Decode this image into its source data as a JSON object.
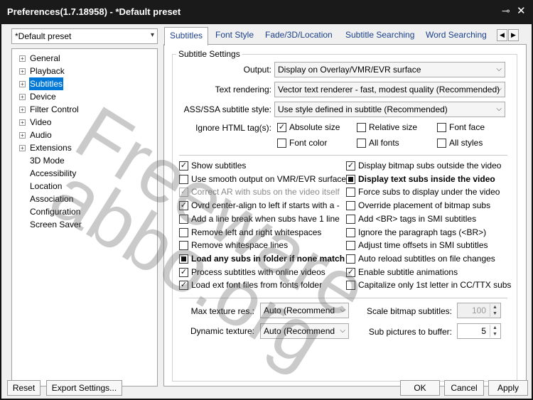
{
  "window": {
    "title": "Preferences(1.7.18958) - *Default preset",
    "pin_icon": "pin-icon",
    "close_icon": "close-icon"
  },
  "preset": {
    "value": "*Default preset"
  },
  "tree": [
    {
      "label": "General",
      "expandable": true
    },
    {
      "label": "Playback",
      "expandable": true
    },
    {
      "label": "Subtitles",
      "expandable": true,
      "selected": true
    },
    {
      "label": "Device",
      "expandable": true
    },
    {
      "label": "Filter Control",
      "expandable": true
    },
    {
      "label": "Video",
      "expandable": true
    },
    {
      "label": "Audio",
      "expandable": true
    },
    {
      "label": "Extensions",
      "expandable": true
    },
    {
      "label": "3D Mode",
      "expandable": false
    },
    {
      "label": "Accessibility",
      "expandable": false
    },
    {
      "label": "Location",
      "expandable": false
    },
    {
      "label": "Association",
      "expandable": false
    },
    {
      "label": "Configuration",
      "expandable": false
    },
    {
      "label": "Screen Saver",
      "expandable": false
    }
  ],
  "tabs": [
    "Subtitles",
    "Font Style",
    "Fade/3D/Location",
    "Subtitle Searching",
    "Word Searching"
  ],
  "settings": {
    "group_title": "Subtitle Settings",
    "output_label": "Output:",
    "output_value": "Display on Overlay/VMR/EVR surface",
    "text_rendering_label": "Text rendering:",
    "text_rendering_value": "Vector text renderer - fast, modest quality (Recommended)",
    "ass_label": "ASS/SSA subtitle style:",
    "ass_value": "Use style defined in subtitle (Recommended)",
    "html_label": "Ignore HTML tag(s):",
    "html_tags": [
      {
        "label": "Absolute size",
        "checked": true
      },
      {
        "label": "Relative size",
        "checked": false
      },
      {
        "label": "Font face",
        "checked": false
      },
      {
        "label": "Font color",
        "checked": false
      },
      {
        "label": "All fonts",
        "checked": false
      },
      {
        "label": "All styles",
        "checked": false
      }
    ]
  },
  "left_options": [
    {
      "label": "Show subtitles",
      "state": "checked"
    },
    {
      "label": "Use smooth output on VMR/EVR surface",
      "state": "unchecked"
    },
    {
      "label": "Correct AR with subs on the video itself",
      "state": "checked",
      "disabled": true
    },
    {
      "label": "Ovrd center-align to left if starts with a -",
      "state": "checked"
    },
    {
      "label": "Add a line break when subs have 1 line",
      "state": "unchecked"
    },
    {
      "label": "Remove left and right whitespaces",
      "state": "unchecked"
    },
    {
      "label": "Remove whitespace lines",
      "state": "unchecked"
    },
    {
      "label": "Load any subs in folder if none match",
      "state": "indeterminate",
      "bold": true
    },
    {
      "label": "Process subtitles with online videos",
      "state": "checked"
    },
    {
      "label": "Load ext font files from fonts folder",
      "state": "checked"
    }
  ],
  "right_options": [
    {
      "label": "Display bitmap subs outside the video",
      "state": "checked"
    },
    {
      "label": "Display text subs inside the video",
      "state": "indeterminate",
      "bold": true
    },
    {
      "label": "Force subs to display under the video",
      "state": "unchecked"
    },
    {
      "label": "Override placement of bitmap subs",
      "state": "unchecked"
    },
    {
      "label": "Add <BR> tags in SMI subtitles",
      "state": "unchecked"
    },
    {
      "label": "Ignore the paragraph tags (<BR>)",
      "state": "unchecked"
    },
    {
      "label": "Adjust time offsets in SMI subtitles",
      "state": "unchecked"
    },
    {
      "label": "Auto reload subtitles on file changes",
      "state": "unchecked"
    },
    {
      "label": "Enable subtitle animations",
      "state": "checked"
    },
    {
      "label": "Capitalize only 1st letter in CC/TTX subs",
      "state": "unchecked"
    }
  ],
  "bottom": {
    "max_texture_label": "Max texture res.:",
    "max_texture_value": "Auto (Recommend",
    "dynamic_texture_label": "Dynamic texture:",
    "dynamic_texture_value": "Auto (Recommend",
    "scale_label": "Scale bitmap subtitles:",
    "scale_value": "100",
    "sub_pictures_label": "Sub pictures to buffer:",
    "sub_pictures_value": "5"
  },
  "buttons": {
    "reset": "Reset",
    "export": "Export Settings...",
    "ok": "OK",
    "cancel": "Cancel",
    "apply": "Apply"
  },
  "watermark": [
    "Freeware",
    "abbo.org"
  ]
}
